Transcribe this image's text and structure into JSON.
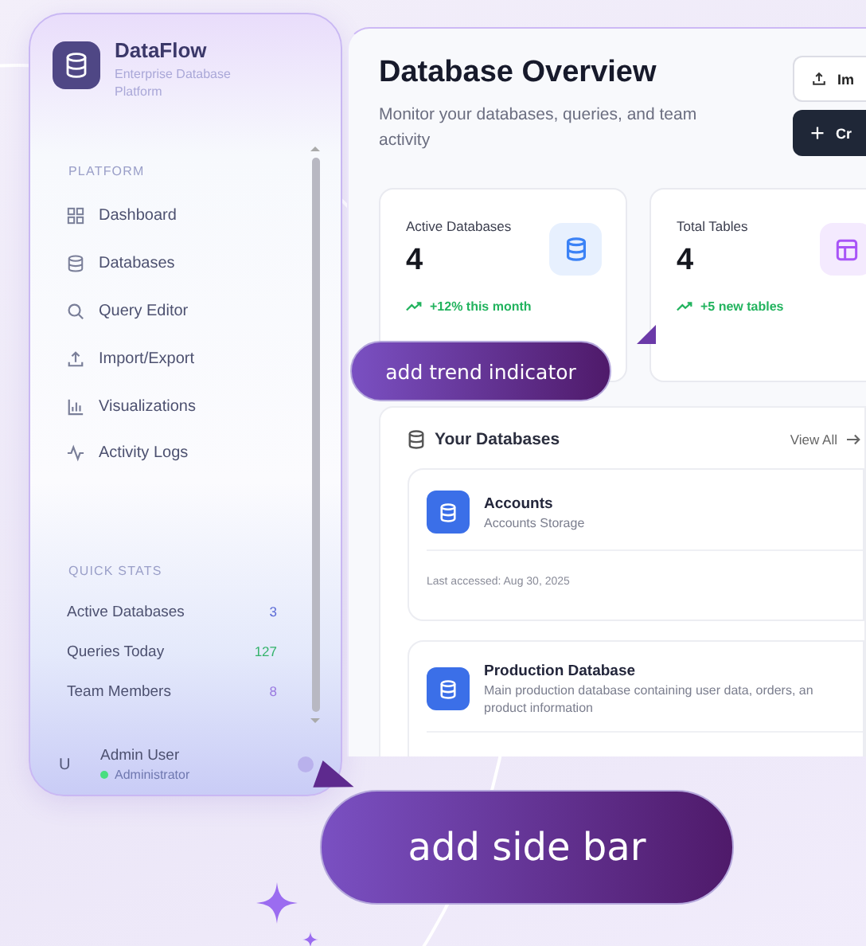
{
  "sidebar": {
    "brand": {
      "name": "DataFlow",
      "subtitle": "Enterprise Database Platform"
    },
    "platform_label": "PLATFORM",
    "nav_items": [
      {
        "label": "Dashboard"
      },
      {
        "label": "Databases"
      },
      {
        "label": "Query Editor"
      },
      {
        "label": "Import/Export"
      },
      {
        "label": "Visualizations"
      },
      {
        "label": "Activity Logs"
      }
    ],
    "quick_stats_label": "QUICK STATS",
    "quick_stats": [
      {
        "label": "Active Databases",
        "value": "3",
        "color": "#5b6bd6"
      },
      {
        "label": "Queries Today",
        "value": "127",
        "color": "#34b36b"
      },
      {
        "label": "Team Members",
        "value": "8",
        "color": "#9b7be0"
      }
    ],
    "user": {
      "initial": "U",
      "name": "Admin User",
      "role": "Administrator",
      "online": true
    }
  },
  "main": {
    "title": "Database Overview",
    "subtitle": "Monitor your databases, queries, and team activity",
    "buttons": [
      {
        "kind": "outline",
        "label": "Im"
      },
      {
        "kind": "primary",
        "label": "Cr"
      }
    ],
    "stats": [
      {
        "label": "Active Databases",
        "value": "4",
        "trend": "+12% this month",
        "color": "#3b82f6"
      },
      {
        "label": "Total Tables",
        "value": "4",
        "trend": "+5 new tables",
        "color": "#a855f7"
      }
    ],
    "databases": {
      "title": "Your Databases",
      "view_all": "View All",
      "items": [
        {
          "name": "Accounts",
          "description_lines": [
            "Accounts Storage"
          ],
          "last_accessed": "Last accessed: Aug 30, 2025"
        },
        {
          "name": "Production Database",
          "description_lines": [
            "Main production database containing user data, orders, an",
            "product information"
          ]
        }
      ]
    }
  },
  "callouts": [
    {
      "text": "add trend indicator"
    },
    {
      "text": "add side bar"
    }
  ]
}
